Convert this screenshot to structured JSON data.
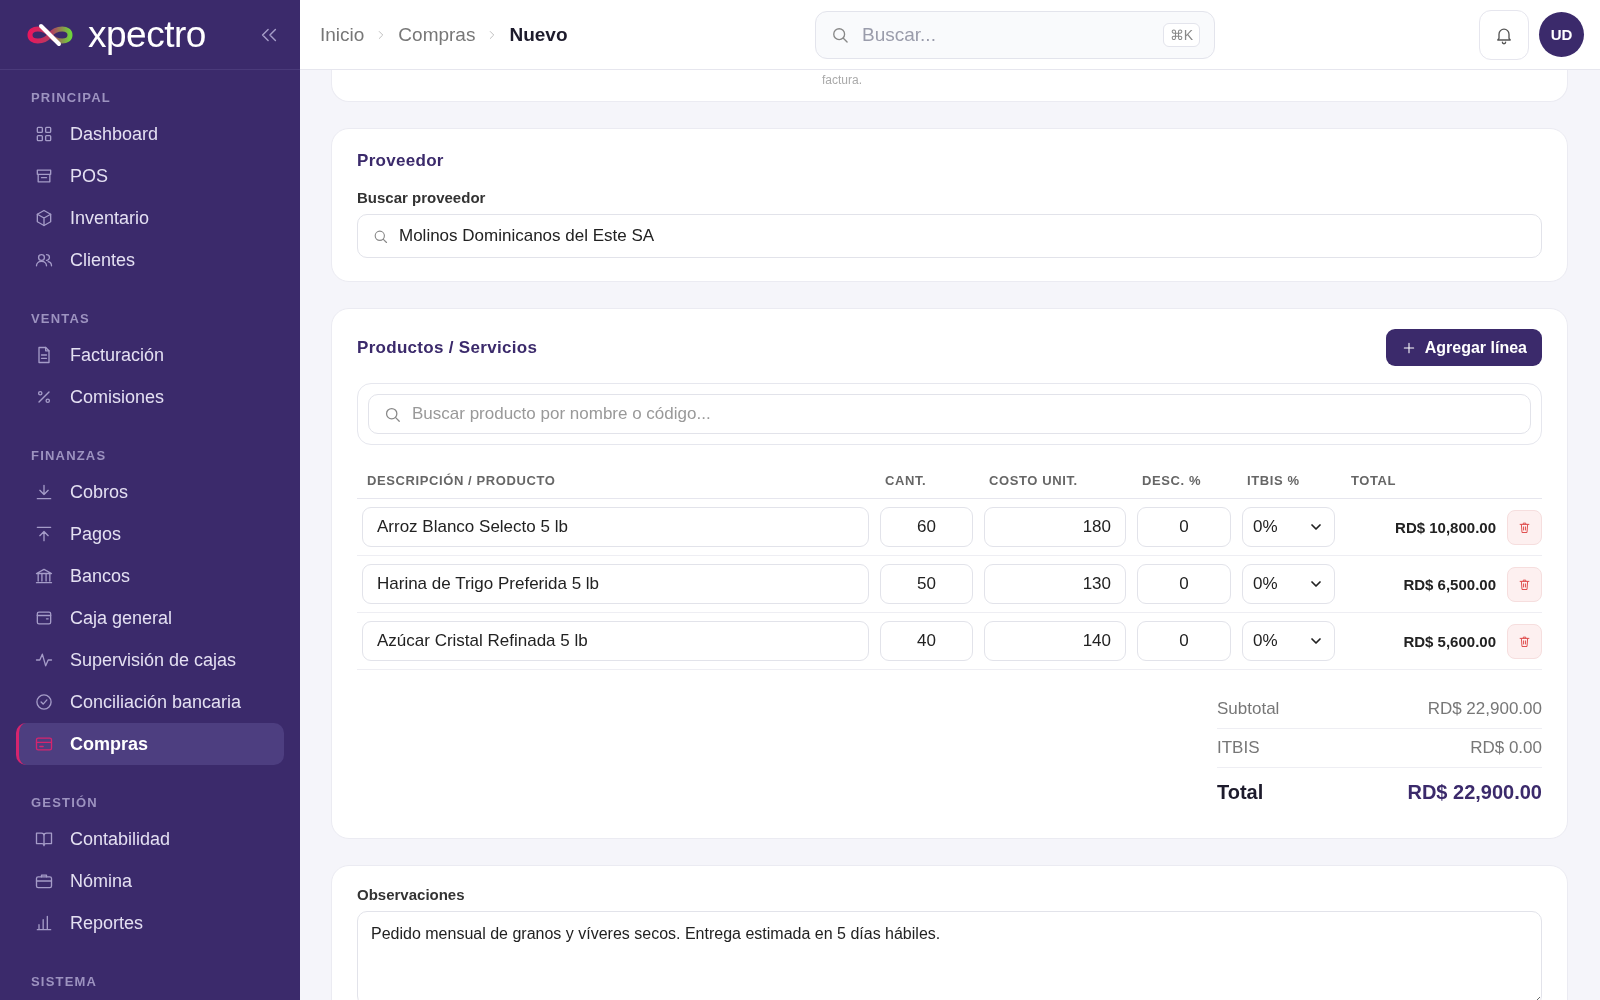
{
  "sidebar": {
    "logo": "xpectro",
    "sections": [
      {
        "title": "PRINCIPAL",
        "items": [
          {
            "label": "Dashboard",
            "selected": false
          },
          {
            "label": "POS",
            "selected": false
          },
          {
            "label": "Inventario",
            "selected": false
          },
          {
            "label": "Clientes",
            "selected": false
          }
        ]
      },
      {
        "title": "VENTAS",
        "items": [
          {
            "label": "Facturación",
            "selected": false
          },
          {
            "label": "Comisiones",
            "selected": false
          }
        ]
      },
      {
        "title": "FINANZAS",
        "items": [
          {
            "label": "Cobros",
            "selected": false
          },
          {
            "label": "Pagos",
            "selected": false
          },
          {
            "label": "Bancos",
            "selected": false
          },
          {
            "label": "Caja general",
            "selected": false
          },
          {
            "label": "Supervisión de cajas",
            "selected": false
          },
          {
            "label": "Conciliación bancaria",
            "selected": false
          },
          {
            "label": "Compras",
            "selected": true
          }
        ]
      },
      {
        "title": "GESTIÓN",
        "items": [
          {
            "label": "Contabilidad",
            "selected": false
          },
          {
            "label": "Nómina",
            "selected": false
          },
          {
            "label": "Reportes",
            "selected": false
          }
        ]
      },
      {
        "title": "SISTEMA"
      }
    ]
  },
  "topbar": {
    "breadcrumb": [
      "Inicio",
      "Compras",
      "Nuevo"
    ],
    "search": {
      "placeholder": "Buscar...",
      "shortcut": "⌘K"
    },
    "avatar": "UD"
  },
  "previous_card": {
    "text": "factura."
  },
  "supplier": {
    "title": "Proveedor",
    "label": "Buscar proveedor",
    "value": "Molinos Dominicanos del Este SA"
  },
  "products": {
    "title": "Productos / Servicios",
    "add_button": "Agregar línea",
    "search": {
      "placeholder": "Buscar producto por nombre o código..."
    },
    "columns": [
      "DESCRIPCIÓN / PRODUCTO",
      "CANT.",
      "COSTO UNIT.",
      "DESC. %",
      "ITBIS %",
      "TOTAL"
    ],
    "rows": [
      {
        "description": "Arroz Blanco Selecto 5 lb",
        "quantity": "60",
        "unit_cost": "180",
        "discount": "0",
        "itbis": "0%",
        "total": "RD$ 10,800.00"
      },
      {
        "description": "Harina de Trigo Preferida 5 lb",
        "quantity": "50",
        "unit_cost": "130",
        "discount": "0",
        "itbis": "0%",
        "total": "RD$ 6,500.00"
      },
      {
        "description": "Azúcar Cristal Refinada 5 lb",
        "quantity": "40",
        "unit_cost": "140",
        "discount": "0",
        "itbis": "0%",
        "total": "RD$ 5,600.00"
      }
    ],
    "summary": [
      {
        "label": "Subtotal",
        "value": "RD$ 22,900.00",
        "kind": "line"
      },
      {
        "label": "ITBIS",
        "value": "RD$ 0.00",
        "kind": "line"
      },
      {
        "label": "Total",
        "value": "RD$ 22,900.00",
        "kind": "total"
      }
    ]
  },
  "notes": {
    "label": "Observaciones",
    "value": "Pedido mensual de granos y víveres secos. Entrega estimada en 5 días hábiles."
  }
}
